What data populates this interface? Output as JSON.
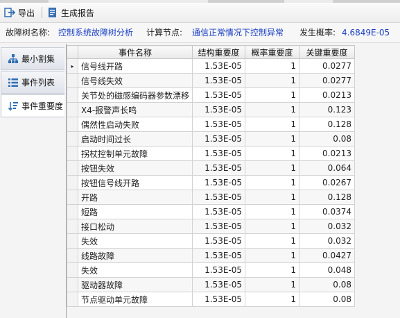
{
  "toolbar": {
    "export_label": "导出",
    "report_label": "生成报告"
  },
  "info": {
    "tree_label": "故障树名称:",
    "tree_value": "控制系统故障树分析",
    "node_label": "计算节点:",
    "node_value": "通信正常情况下控制异常",
    "prob_label": "发生概率:",
    "prob_value": "4.6849E-05"
  },
  "sidebar": {
    "items": [
      {
        "label": "最小割集",
        "icon": "tree-hierarchy-icon"
      },
      {
        "label": "事件列表",
        "icon": "list-icon"
      },
      {
        "label": "事件重要度",
        "icon": "sort-descending-icon"
      }
    ],
    "active_index": 2
  },
  "table": {
    "columns": [
      "事件名称",
      "结构重要度",
      "概率重要度",
      "关键重要度"
    ],
    "selected_row_marker": "▸",
    "rows": [
      {
        "name": "信号线开路",
        "structural": "1.53E-05",
        "probability": "1",
        "critical": "0.0277"
      },
      {
        "name": "信号线失效",
        "structural": "1.53E-05",
        "probability": "1",
        "critical": "0.0277"
      },
      {
        "name": "关节处的磁感编码器参数漂移",
        "structural": "1.53E-05",
        "probability": "1",
        "critical": "0.0213"
      },
      {
        "name": "X4-报警声长鸣",
        "structural": "1.53E-05",
        "probability": "1",
        "critical": "0.123"
      },
      {
        "name": "偶然性启动失败",
        "structural": "1.53E-05",
        "probability": "1",
        "critical": "0.128"
      },
      {
        "name": "启动时间过长",
        "structural": "1.53E-05",
        "probability": "1",
        "critical": "0.08"
      },
      {
        "name": "拐杖控制单元故障",
        "structural": "1.53E-05",
        "probability": "1",
        "critical": "0.0213"
      },
      {
        "name": "按钮失效",
        "structural": "1.53E-05",
        "probability": "1",
        "critical": "0.064"
      },
      {
        "name": "按钮信号线开路",
        "structural": "1.53E-05",
        "probability": "1",
        "critical": "0.0267"
      },
      {
        "name": "开路",
        "structural": "1.53E-05",
        "probability": "1",
        "critical": "0.128"
      },
      {
        "name": "短路",
        "structural": "1.53E-05",
        "probability": "1",
        "critical": "0.0374"
      },
      {
        "name": "接口松动",
        "structural": "1.53E-05",
        "probability": "1",
        "critical": "0.032"
      },
      {
        "name": "失效",
        "structural": "1.53E-05",
        "probability": "1",
        "critical": "0.032"
      },
      {
        "name": "线路故障",
        "structural": "1.53E-05",
        "probability": "1",
        "critical": "0.0427"
      },
      {
        "name": "失效",
        "structural": "1.53E-05",
        "probability": "1",
        "critical": "0.048"
      },
      {
        "name": "驱动器故障",
        "structural": "1.53E-05",
        "probability": "1",
        "critical": "0.08"
      },
      {
        "name": "节点驱动单元故障",
        "structural": "1.53E-05",
        "probability": "1",
        "critical": "0.08"
      }
    ]
  }
}
